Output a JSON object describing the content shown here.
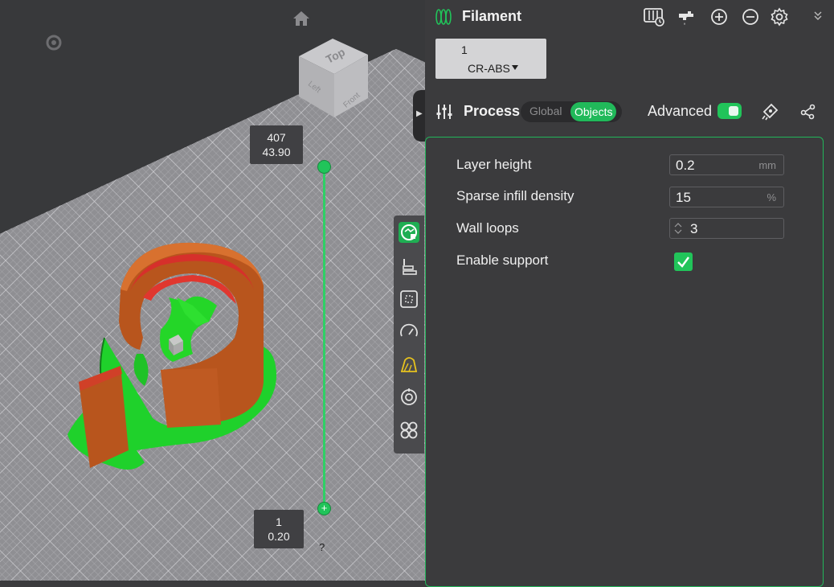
{
  "viewport": {
    "view_cube": {
      "top": "Top",
      "left": "Left",
      "front": "Front"
    },
    "layer_slider": {
      "top_layer": "407",
      "top_height": "43.90",
      "bottom_layer": "1",
      "bottom_height": "0.20",
      "help": "?"
    },
    "toolbar_icons": [
      "preview-icon",
      "layer-align-icon",
      "bounding-box-icon",
      "speed-icon",
      "support-paint-icon",
      "seam-icon",
      "variable-layer-icon"
    ],
    "colors": {
      "accent": "#21c45a",
      "model_wall": "#b5541f",
      "model_top": "#d22e2a",
      "support": "#2fd02a"
    }
  },
  "filament": {
    "title": "Filament",
    "header_icons": [
      "filament-manager-icon",
      "flush-icon",
      "add-icon",
      "remove-icon",
      "settings-icon",
      "collapse-icon"
    ],
    "slot_number": "1",
    "slot_name": "CR-ABS"
  },
  "process": {
    "title": "Process",
    "mode_global": "Global",
    "mode_objects": "Objects",
    "advanced_label": "Advanced",
    "advanced_on": true,
    "params": [
      {
        "label": "Layer height",
        "value": "0.2",
        "unit": "mm"
      },
      {
        "label": "Sparse infill density",
        "value": "15",
        "unit": "%"
      },
      {
        "label": "Wall loops",
        "value": "3",
        "unit": ""
      },
      {
        "label": "Enable support",
        "checked": true
      }
    ]
  }
}
